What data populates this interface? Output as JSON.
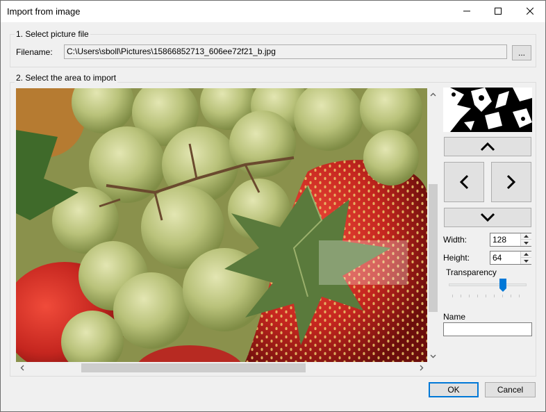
{
  "window": {
    "title": "Import from image",
    "minimize_icon": "minimize-icon",
    "maximize_icon": "maximize-icon",
    "close_icon": "close-icon"
  },
  "section1": {
    "title": "1. Select picture file",
    "filename_label": "Filename:",
    "filename_value": "C:\\Users\\sboll\\Pictures\\15866852713_606ee72f21_b.jpg",
    "browse_label": "..."
  },
  "section2": {
    "title": "2. Select the area to import",
    "image_description": "photo-grapes-strawberries",
    "nav": {
      "up_icon": "chevron-up-icon",
      "left_icon": "chevron-left-icon",
      "right_icon": "chevron-right-icon",
      "down_icon": "chevron-down-icon"
    },
    "width_label": "Width:",
    "width_value": "128",
    "height_label": "Height:",
    "height_value": "64",
    "transparency_label": "Transparency",
    "transparency_level": 0.7,
    "name_label": "Name",
    "name_value": ""
  },
  "footer": {
    "ok_label": "OK",
    "cancel_label": "Cancel"
  },
  "colors": {
    "accent": "#0078d7",
    "window_bg": "#f0f0f0"
  }
}
